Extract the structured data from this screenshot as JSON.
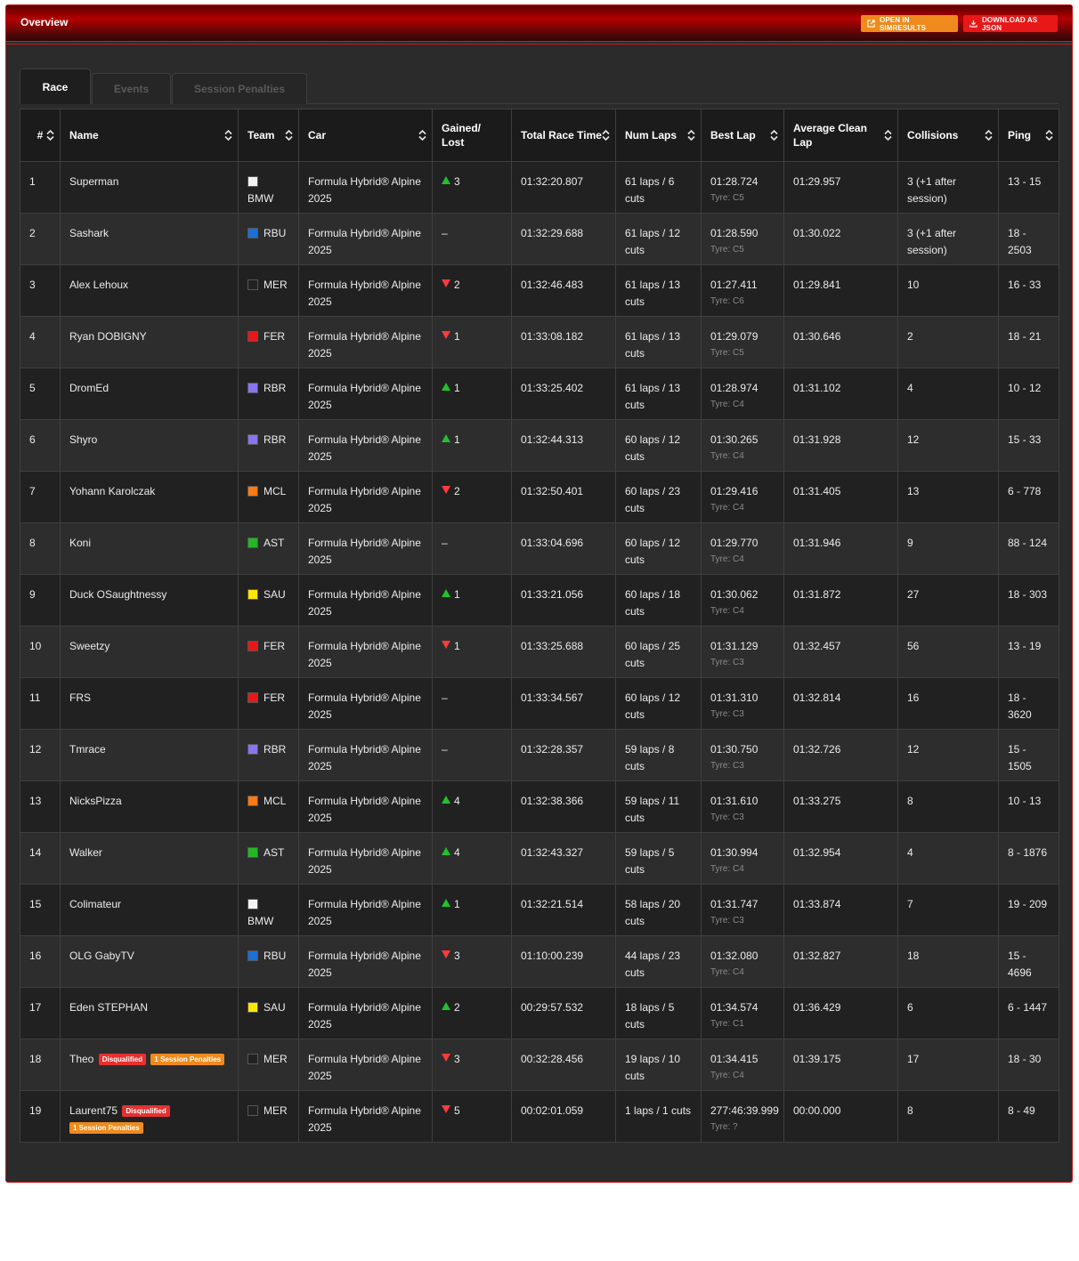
{
  "header": {
    "title": "Overview",
    "open_simresults_label": "OPEN IN SIMRESULTS",
    "download_json_label": "DOWNLOAD AS JSON"
  },
  "tabs": [
    {
      "label": "Race",
      "active": true
    },
    {
      "label": "Events",
      "active": false
    },
    {
      "label": "Session Penalties",
      "active": false
    }
  ],
  "table": {
    "columns": [
      "#",
      "Name",
      "Team",
      "Car",
      "Gained/ Lost",
      "Total Race Time",
      "Num Laps",
      "Best Lap",
      "Average Clean Lap",
      "Collisions",
      "Ping"
    ],
    "rows": [
      {
        "pos": "1",
        "name": "Superman",
        "team": "BMW",
        "team_color": "#f2f2f2",
        "car": "Formula Hybrid® Alpine 2025",
        "change_dir": "up",
        "change": "3",
        "total": "01:32:20.807",
        "laps": "61 laps / 6 cuts",
        "best": "01:28.724",
        "tyre": "Tyre: C5",
        "avg": "01:29.957",
        "collisions": "3 (+1 after session)",
        "ping": "13 - 15"
      },
      {
        "pos": "2",
        "name": "Sashark",
        "team": "RBU",
        "team_color": "#1a70d6",
        "car": "Formula Hybrid® Alpine 2025",
        "change_dir": "none",
        "change": "–",
        "total": "01:32:29.688",
        "laps": "61 laps / 12 cuts",
        "best": "01:28.590",
        "tyre": "Tyre: C5",
        "avg": "01:30.022",
        "collisions": "3 (+1 after session)",
        "ping": "18 - 2503"
      },
      {
        "pos": "3",
        "name": "Alex Lehoux",
        "team": "MER",
        "team_color": "#222222",
        "car": "Formula Hybrid® Alpine 2025",
        "change_dir": "down",
        "change": "2",
        "total": "01:32:46.483",
        "laps": "61 laps / 13 cuts",
        "best": "01:27.411",
        "tyre": "Tyre: C6",
        "avg": "01:29.841",
        "collisions": "10",
        "ping": "16 - 33"
      },
      {
        "pos": "4",
        "name": "Ryan DOBIGNY",
        "team": "FER",
        "team_color": "#e81818",
        "car": "Formula Hybrid® Alpine 2025",
        "change_dir": "down",
        "change": "1",
        "total": "01:33:08.182",
        "laps": "61 laps / 13 cuts",
        "best": "01:29.079",
        "tyre": "Tyre: C5",
        "avg": "01:30.646",
        "collisions": "2",
        "ping": "18 - 21"
      },
      {
        "pos": "5",
        "name": "DromEd",
        "team": "RBR",
        "team_color": "#8a74f0",
        "car": "Formula Hybrid® Alpine 2025",
        "change_dir": "up",
        "change": "1",
        "total": "01:33:25.402",
        "laps": "61 laps / 13 cuts",
        "best": "01:28.974",
        "tyre": "Tyre: C4",
        "avg": "01:31.102",
        "collisions": "4",
        "ping": "10 - 12"
      },
      {
        "pos": "6",
        "name": "Shyro",
        "team": "RBR",
        "team_color": "#8a74f0",
        "car": "Formula Hybrid® Alpine 2025",
        "change_dir": "up",
        "change": "1",
        "total": "01:32:44.313",
        "laps": "60 laps / 12 cuts",
        "best": "01:30.265",
        "tyre": "Tyre: C4",
        "avg": "01:31.928",
        "collisions": "12",
        "ping": "15 - 33"
      },
      {
        "pos": "7",
        "name": "Yohann Karolczak",
        "team": "MCL",
        "team_color": "#ff7a14",
        "car": "Formula Hybrid® Alpine 2025",
        "change_dir": "down",
        "change": "2",
        "total": "01:32:50.401",
        "laps": "60 laps / 23 cuts",
        "best": "01:29.416",
        "tyre": "Tyre: C4",
        "avg": "01:31.405",
        "collisions": "13",
        "ping": "6 - 778"
      },
      {
        "pos": "8",
        "name": "Koni",
        "team": "AST",
        "team_color": "#22b822",
        "car": "Formula Hybrid® Alpine 2025",
        "change_dir": "none",
        "change": "–",
        "total": "01:33:04.696",
        "laps": "60 laps / 12 cuts",
        "best": "01:29.770",
        "tyre": "Tyre: C4",
        "avg": "01:31.946",
        "collisions": "9",
        "ping": "88 - 124"
      },
      {
        "pos": "9",
        "name": "Duck OSaughtnessy",
        "team": "SAU",
        "team_color": "#ffe600",
        "car": "Formula Hybrid® Alpine 2025",
        "change_dir": "up",
        "change": "1",
        "total": "01:33:21.056",
        "laps": "60 laps / 18 cuts",
        "best": "01:30.062",
        "tyre": "Tyre: C4",
        "avg": "01:31.872",
        "collisions": "27",
        "ping": "18 - 303"
      },
      {
        "pos": "10",
        "name": "Sweetzy",
        "team": "FER",
        "team_color": "#e81818",
        "car": "Formula Hybrid® Alpine 2025",
        "change_dir": "down",
        "change": "1",
        "total": "01:33:25.688",
        "laps": "60 laps / 25 cuts",
        "best": "01:31.129",
        "tyre": "Tyre: C3",
        "avg": "01:32.457",
        "collisions": "56",
        "ping": "13 - 19"
      },
      {
        "pos": "11",
        "name": "FRS",
        "team": "FER",
        "team_color": "#e81818",
        "car": "Formula Hybrid® Alpine 2025",
        "change_dir": "none",
        "change": "–",
        "total": "01:33:34.567",
        "laps": "60 laps / 12 cuts",
        "best": "01:31.310",
        "tyre": "Tyre: C3",
        "avg": "01:32.814",
        "collisions": "16",
        "ping": "18 - 3620"
      },
      {
        "pos": "12",
        "name": "Tmrace",
        "team": "RBR",
        "team_color": "#8a74f0",
        "car": "Formula Hybrid® Alpine 2025",
        "change_dir": "none",
        "change": "–",
        "total": "01:32:28.357",
        "laps": "59 laps / 8 cuts",
        "best": "01:30.750",
        "tyre": "Tyre: C3",
        "avg": "01:32.726",
        "collisions": "12",
        "ping": "15 - 1505"
      },
      {
        "pos": "13",
        "name": "NicksPizza",
        "team": "MCL",
        "team_color": "#ff7a14",
        "car": "Formula Hybrid® Alpine 2025",
        "change_dir": "up",
        "change": "4",
        "total": "01:32:38.366",
        "laps": "59 laps / 11 cuts",
        "best": "01:31.610",
        "tyre": "Tyre: C3",
        "avg": "01:33.275",
        "collisions": "8",
        "ping": "10 - 13"
      },
      {
        "pos": "14",
        "name": "Walker",
        "team": "AST",
        "team_color": "#22b822",
        "car": "Formula Hybrid® Alpine 2025",
        "change_dir": "up",
        "change": "4",
        "total": "01:32:43.327",
        "laps": "59 laps / 5 cuts",
        "best": "01:30.994",
        "tyre": "Tyre: C4",
        "avg": "01:32.954",
        "collisions": "4",
        "ping": "8 - 1876"
      },
      {
        "pos": "15",
        "name": "Colimateur",
        "team": "BMW",
        "team_color": "#f2f2f2",
        "car": "Formula Hybrid® Alpine 2025",
        "change_dir": "up",
        "change": "1",
        "total": "01:32:21.514",
        "laps": "58 laps / 20 cuts",
        "best": "01:31.747",
        "tyre": "Tyre: C3",
        "avg": "01:33.874",
        "collisions": "7",
        "ping": "19 - 209"
      },
      {
        "pos": "16",
        "name": "OLG GabyTV",
        "team": "RBU",
        "team_color": "#1a70d6",
        "car": "Formula Hybrid® Alpine 2025",
        "change_dir": "down",
        "change": "3",
        "total": "01:10:00.239",
        "laps": "44 laps / 23 cuts",
        "best": "01:32.080",
        "tyre": "Tyre: C4",
        "avg": "01:32.827",
        "collisions": "18",
        "ping": "15 - 4696"
      },
      {
        "pos": "17",
        "name": "Eden STEPHAN",
        "team": "SAU",
        "team_color": "#ffe600",
        "car": "Formula Hybrid® Alpine 2025",
        "change_dir": "up",
        "change": "2",
        "total": "00:29:57.532",
        "laps": "18 laps / 5 cuts",
        "best": "01:34.574",
        "tyre": "Tyre: C1",
        "avg": "01:36.429",
        "collisions": "6",
        "ping": "6 - 1447"
      },
      {
        "pos": "18",
        "name": "Theo",
        "badges": [
          "Disqualified",
          "1 Session Penalties"
        ],
        "team": "MER",
        "team_color": "#222222",
        "car": "Formula Hybrid® Alpine 2025",
        "change_dir": "down",
        "change": "3",
        "total": "00:32:28.456",
        "laps": "19 laps / 10 cuts",
        "best": "01:34.415",
        "tyre": "Tyre: C4",
        "avg": "01:39.175",
        "collisions": "17",
        "ping": "18 - 30"
      },
      {
        "pos": "19",
        "name": "Laurent75",
        "badges": [
          "Disqualified",
          "1 Session Penalties"
        ],
        "team": "MER",
        "team_color": "#222222",
        "car": "Formula Hybrid® Alpine 2025",
        "change_dir": "down",
        "change": "5",
        "total": "00:02:01.059",
        "laps": "1 laps / 1 cuts",
        "best": "277:46:39.999",
        "tyre": "Tyre: ?",
        "avg": "00:00.000",
        "collisions": "8",
        "ping": "8 - 49"
      }
    ]
  },
  "icons": {
    "external_link": "external-link-icon",
    "download": "download-icon",
    "sort": "sort-icon"
  },
  "colors": {
    "accent_red": "#e81818",
    "accent_orange": "#f08a1c",
    "gain_green": "#1fc12d",
    "loss_red": "#ff3a3a"
  }
}
